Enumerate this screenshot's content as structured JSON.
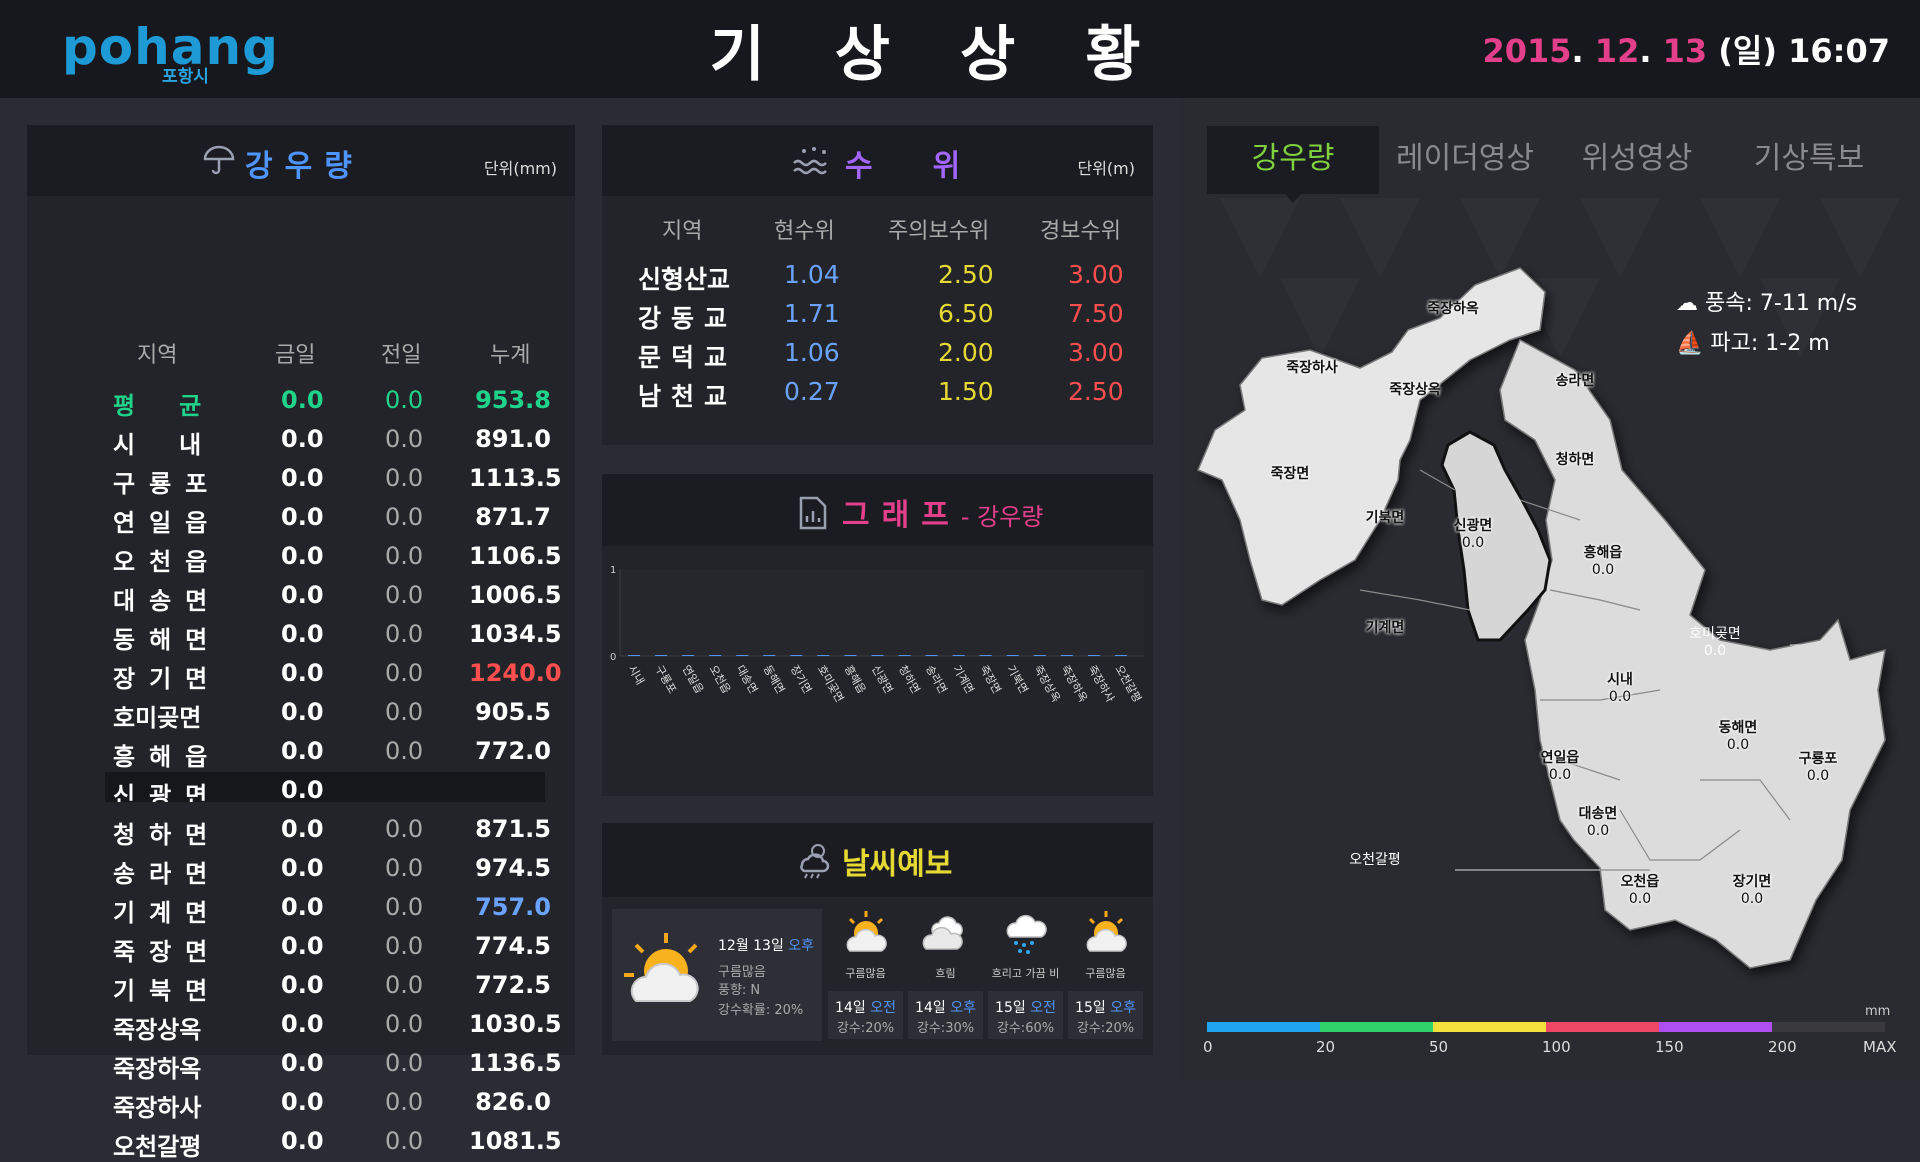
{
  "header": {
    "logo_word": "pohang",
    "logo_sub": "포항시",
    "title": "기상상황",
    "date_year": "2015",
    "date_month": "12",
    "date_day": "13",
    "date_weekday": "(일)",
    "time": "16:07"
  },
  "rainfall": {
    "title": "강우량",
    "unit": "단위(mm)",
    "headers": [
      "지역",
      "금일",
      "전일",
      "누계"
    ],
    "rows": [
      {
        "name": "평균",
        "today": "0.0",
        "prev": "0.0",
        "total": "953.8"
      },
      {
        "name": "시내",
        "today": "0.0",
        "prev": "0.0",
        "total": "891.0"
      },
      {
        "name": "구룡포",
        "today": "0.0",
        "prev": "0.0",
        "total": "1113.5"
      },
      {
        "name": "연일읍",
        "today": "0.0",
        "prev": "0.0",
        "total": "871.7"
      },
      {
        "name": "오천읍",
        "today": "0.0",
        "prev": "0.0",
        "total": "1106.5"
      },
      {
        "name": "대송면",
        "today": "0.0",
        "prev": "0.0",
        "total": "1006.5"
      },
      {
        "name": "동해면",
        "today": "0.0",
        "prev": "0.0",
        "total": "1034.5"
      },
      {
        "name": "장기면",
        "today": "0.0",
        "prev": "0.0",
        "total": "1240.0"
      },
      {
        "name": "호미곶면",
        "today": "0.0",
        "prev": "0.0",
        "total": "905.5"
      },
      {
        "name": "흥해읍",
        "today": "0.0",
        "prev": "0.0",
        "total": "772.0"
      },
      {
        "name": "신광면",
        "today": "0.0",
        "prev": "",
        "total": ""
      },
      {
        "name": "청하면",
        "today": "0.0",
        "prev": "0.0",
        "total": "871.5"
      },
      {
        "name": "송라면",
        "today": "0.0",
        "prev": "0.0",
        "total": "974.5"
      },
      {
        "name": "기계면",
        "today": "0.0",
        "prev": "0.0",
        "total": "757.0"
      },
      {
        "name": "죽장면",
        "today": "0.0",
        "prev": "0.0",
        "total": "774.5"
      },
      {
        "name": "기북면",
        "today": "0.0",
        "prev": "0.0",
        "total": "772.5"
      },
      {
        "name": "죽장상옥",
        "today": "0.0",
        "prev": "0.0",
        "total": "1030.5"
      },
      {
        "name": "죽장하옥",
        "today": "0.0",
        "prev": "0.0",
        "total": "1136.5"
      },
      {
        "name": "죽장하사",
        "today": "0.0",
        "prev": "0.0",
        "total": "826.0"
      },
      {
        "name": "오천갈평",
        "today": "0.0",
        "prev": "0.0",
        "total": "1081.5"
      }
    ],
    "colors": {
      "average": "#1fd38b",
      "max": "#ff4e4e",
      "min": "#6aa3ff"
    }
  },
  "water_level": {
    "title": "수위",
    "unit": "단위(m)",
    "headers": [
      "지역",
      "현수위",
      "주의보수위",
      "경보수위"
    ],
    "rows": [
      {
        "name": "신형산교",
        "current": "1.04",
        "watch": "2.50",
        "warning": "3.00"
      },
      {
        "name": "강동교",
        "current": "1.71",
        "watch": "6.50",
        "warning": "7.50"
      },
      {
        "name": "문덕교",
        "current": "1.06",
        "watch": "2.00",
        "warning": "3.00"
      },
      {
        "name": "남천교",
        "current": "0.27",
        "watch": "1.50",
        "warning": "2.50"
      }
    ]
  },
  "graph": {
    "title": "그래프",
    "subtitle": "- 강우량"
  },
  "chart_data": {
    "type": "bar",
    "title": "",
    "xlabel": "",
    "ylabel": "",
    "ylim": [
      0,
      1
    ],
    "yticks": [
      "1",
      "0"
    ],
    "categories": [
      "시내",
      "구룡포",
      "연일읍",
      "오천읍",
      "대송면",
      "동해면",
      "장기면",
      "호미곶면",
      "흥해읍",
      "신광면",
      "청하면",
      "송라면",
      "기계면",
      "죽장면",
      "기북면",
      "죽장상옥",
      "죽장하옥",
      "죽장하사",
      "오천갈평"
    ],
    "values": [
      0,
      0,
      0,
      0,
      0,
      0,
      0,
      0,
      0,
      0,
      0,
      0,
      0,
      0,
      0,
      0,
      0,
      0,
      0
    ],
    "grid": true
  },
  "forecast": {
    "title": "날씨예보",
    "today": {
      "date": "12월 13일",
      "ampm": "오후",
      "sky": "구름많음",
      "wind": "풍향: N",
      "rain": "강수확률: 20%"
    },
    "items": [
      {
        "label": "구름많음",
        "date": "14일",
        "ampm": "오전",
        "rain": "강수:20%",
        "icon": "cloud-sun-icon"
      },
      {
        "label": "흐림",
        "date": "14일",
        "ampm": "오후",
        "rain": "강수:30%",
        "icon": "cloud-icon"
      },
      {
        "label": "흐리고 가끔 비",
        "date": "15일",
        "ampm": "오전",
        "rain": "강수:60%",
        "icon": "cloud-rain-icon"
      },
      {
        "label": "구름많음",
        "date": "15일",
        "ampm": "오후",
        "rain": "강수:20%",
        "icon": "cloud-sun-icon"
      }
    ]
  },
  "map_tabs": [
    "강우량",
    "레이더영상",
    "위성영상",
    "기상특보"
  ],
  "marine": {
    "wind": "풍속: 7-11 m/s",
    "wave": "파고: 1-2 m"
  },
  "map_labels": [
    {
      "name": "죽장하옥",
      "val": ""
    },
    {
      "name": "죽장하사",
      "val": ""
    },
    {
      "name": "죽장상옥",
      "val": ""
    },
    {
      "name": "송라면",
      "val": ""
    },
    {
      "name": "죽장면",
      "val": ""
    },
    {
      "name": "청하면",
      "val": ""
    },
    {
      "name": "기북면",
      "val": ""
    },
    {
      "name": "신광면",
      "val": "0.0"
    },
    {
      "name": "흥해읍",
      "val": "0.0"
    },
    {
      "name": "기계면",
      "val": ""
    },
    {
      "name": "호미곶면",
      "val": "0.0"
    },
    {
      "name": "시내",
      "val": "0.0"
    },
    {
      "name": "연일읍",
      "val": "0.0"
    },
    {
      "name": "동해면",
      "val": "0.0"
    },
    {
      "name": "구룡포",
      "val": "0.0"
    },
    {
      "name": "대송면",
      "val": "0.0"
    },
    {
      "name": "오천갈평",
      "val": ""
    },
    {
      "name": "오천읍",
      "val": "0.0"
    },
    {
      "name": "장기면",
      "val": "0.0"
    }
  ],
  "legend": {
    "unit": "mm",
    "ticks": [
      "0",
      "20",
      "50",
      "100",
      "150",
      "200",
      "MAX"
    ],
    "colors": [
      "#1ea6f0",
      "#2fd36b",
      "#f5e13b",
      "#ef4766",
      "#b04ff0",
      "#3a3a3e"
    ]
  }
}
